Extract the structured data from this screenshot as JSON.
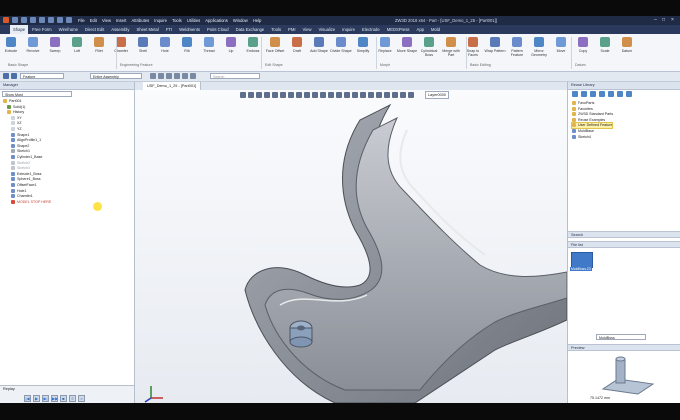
{
  "menu": [
    "File",
    "Edit",
    "View",
    "Insert",
    "Attributes",
    "Inquire",
    "Tools",
    "Utilities",
    "Applications",
    "Window",
    "Help"
  ],
  "window_title": "ZW3D 2018 x64 - Part - [USF_Demo_1_25 - [Part001]]",
  "tabs": [
    "Shape",
    "Free Form",
    "Wireframe",
    "Direct Edit",
    "Assembly",
    "Sheet Metal",
    "FTI",
    "Weldments",
    "Point Cloud",
    "Data Exchange",
    "Tools",
    "PMI",
    "View",
    "Visualize",
    "Inquire",
    "Electrode",
    "MEDSPress",
    "App",
    "Mold"
  ],
  "ribbon": {
    "buttons": [
      "Extrude",
      "Revolve",
      "Sweep",
      "Loft",
      "Fillet",
      "Chamfer",
      "Shell",
      "Hole",
      "Rib",
      "Thread",
      "Lip",
      "Emboss",
      "Face Offset",
      "Draft",
      "Add Shape",
      "Divide Shape",
      "Simplify",
      "Replace",
      "Move Shape",
      "Cylindrical Boss",
      "Merge with Part",
      "Snap to Faces",
      "Wrap Pattern",
      "Pattern Feature",
      "Mirror Geometry",
      "Move",
      "Copy",
      "Scale",
      "Datum"
    ],
    "groups": [
      "Basic Shape",
      "Engineering Feature",
      "Edit Shape",
      "Morph",
      "Basic Editing",
      "Datum"
    ]
  },
  "toolrow": {
    "filter_value": "Feature",
    "scope_value": "Entire Assembly",
    "search_placeholder": "Search"
  },
  "left_panel": {
    "title": "Manager",
    "filter": "Show Most",
    "tree": [
      {
        "label": "Part001",
        "style": "normal",
        "indent": 0
      },
      {
        "label": "Solid(1)",
        "style": "normal",
        "indent": 1
      },
      {
        "label": "History",
        "style": "normal",
        "indent": 1
      },
      {
        "label": "XY",
        "style": "normal",
        "indent": 2
      },
      {
        "label": "XZ",
        "style": "normal",
        "indent": 2
      },
      {
        "label": "YZ",
        "style": "normal",
        "indent": 2
      },
      {
        "label": "Shape1",
        "style": "normal",
        "indent": 2
      },
      {
        "label": "AlignProfile1_1",
        "style": "normal",
        "indent": 2
      },
      {
        "label": "Shape2",
        "style": "normal",
        "indent": 2
      },
      {
        "label": "Sketch1",
        "style": "normal",
        "indent": 2
      },
      {
        "label": "Cylinder1_Base",
        "style": "normal",
        "indent": 2
      },
      {
        "label": "Sketch2",
        "style": "muted",
        "indent": 2
      },
      {
        "label": "Sketch3",
        "style": "muted",
        "indent": 2
      },
      {
        "label": "Extrude1_Boss",
        "style": "normal",
        "indent": 2
      },
      {
        "label": "Sphere1_Boss",
        "style": "normal",
        "indent": 2
      },
      {
        "label": "OffsetFace1",
        "style": "normal",
        "indent": 2
      },
      {
        "label": "Hole1",
        "style": "normal",
        "indent": 2
      },
      {
        "label": "Chamfer1",
        "style": "normal",
        "indent": 2
      },
      {
        "label": "MODEL STOP HERE",
        "style": "red",
        "indent": 2
      }
    ],
    "replay_title": "Replay"
  },
  "doc_tab": "USF_Demo_1_25 - [Part001]",
  "layer": "Layer0000",
  "right_panel": {
    "title": "Reuse Library",
    "items": [
      "FavoParts",
      "Favorites",
      "ZW3D Standard Parts",
      "Reuse Examples",
      "User Defined Feature",
      "MoldBase",
      "Sketch4"
    ],
    "search_title": "Search",
    "file_list_title": "File list",
    "file_item": "MoldBoss.Z3",
    "file_combo": "MoldBoss",
    "preview_title": "Preview",
    "preview_value": "75.1472 mm"
  }
}
